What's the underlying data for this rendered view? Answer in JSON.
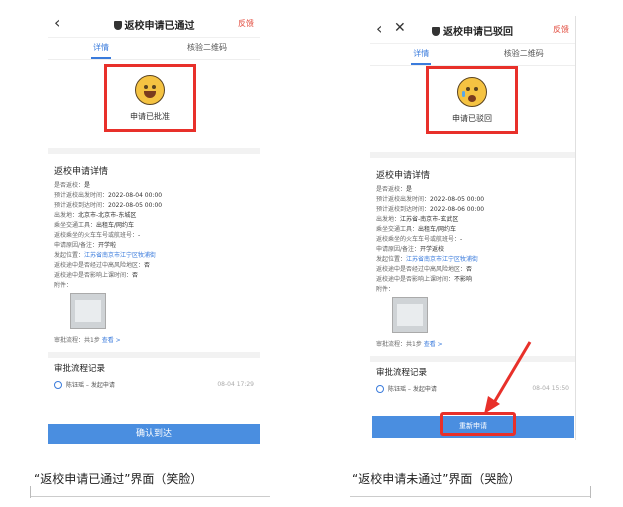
{
  "left": {
    "nav": {
      "back": "‹",
      "title": "返校申请已通过",
      "feedback": "反馈"
    },
    "tabs": [
      "详情",
      "核验二维码"
    ],
    "status": {
      "face": "smile-face-icon",
      "label": "申请已批准"
    },
    "section_title": "返校申请详情",
    "rows": [
      {
        "k": "是否返校：",
        "v": "是"
      },
      {
        "k": "预计返校出发时间：",
        "v": "2022-08-04 00:00"
      },
      {
        "k": "预计返校到达时间：",
        "v": "2022-08-05 00:00"
      },
      {
        "k": "出发地：",
        "v": "北京市-北京市-东城区"
      },
      {
        "k": "乘坐交通工具：",
        "v": "出租车/网约车"
      },
      {
        "k": "返校乘坐的火车车号或航班号：",
        "v": "-"
      },
      {
        "k": "申请原因/备注：",
        "v": "开学啦"
      },
      {
        "k": "发起位置：",
        "v": "江苏省南京市江宁区牧浦街",
        "link": true
      },
      {
        "k": "返校途中是否经过中高风险地区：",
        "v": "否"
      },
      {
        "k": "返校途中是否影响上课时间：",
        "v": "否"
      },
      {
        "k": "附件：",
        "v": ""
      }
    ],
    "approve": {
      "text": "审批流程：共1步",
      "link": "查看 >"
    },
    "flow_title": "审批流程记录",
    "flow_item": {
      "name": "陈钰瑶 – 发起申请",
      "time": "08-04 17:29"
    },
    "button": "确认到达"
  },
  "right": {
    "nav": {
      "back": "‹",
      "close": "✕",
      "title": "返校申请已驳回",
      "feedback": "反馈"
    },
    "tabs": [
      "详情",
      "核验二维码"
    ],
    "status": {
      "face": "crying-face-icon",
      "label": "申请已驳回"
    },
    "section_title": "返校申请详情",
    "rows": [
      {
        "k": "是否返校：",
        "v": "是"
      },
      {
        "k": "预计返校出发时间：",
        "v": "2022-08-05 00:00"
      },
      {
        "k": "预计返校到达时间：",
        "v": "2022-08-06 00:00"
      },
      {
        "k": "出发地：",
        "v": "江苏省-南京市-玄武区"
      },
      {
        "k": "乘坐交通工具：",
        "v": "出租车/网约车"
      },
      {
        "k": "返校乘坐的火车车号或航班号：",
        "v": "-"
      },
      {
        "k": "申请原因/备注：",
        "v": "开学返校"
      },
      {
        "k": "发起位置：",
        "v": "江苏省南京市江宁区牧浦街",
        "link": true
      },
      {
        "k": "返校途中是否经过中高风险地区：",
        "v": "否"
      },
      {
        "k": "返校途中是否影响上课时间：",
        "v": "不影响"
      },
      {
        "k": "附件：",
        "v": ""
      }
    ],
    "approve": {
      "text": "审批流程：共1步",
      "link": "查看 >"
    },
    "flow_title": "审批流程记录",
    "flow_item": {
      "name": "陈钰瑶 – 发起申请",
      "time": "08-04 15:50"
    },
    "button": "重新申请"
  },
  "captions": {
    "left": "“返校申请已通过”界面（笑脸）",
    "right": "“返校申请未通过”界面（哭脸）"
  },
  "colors": {
    "accent": "#3a7bdc",
    "alert": "#e8302a",
    "button": "#4a8ee0"
  }
}
